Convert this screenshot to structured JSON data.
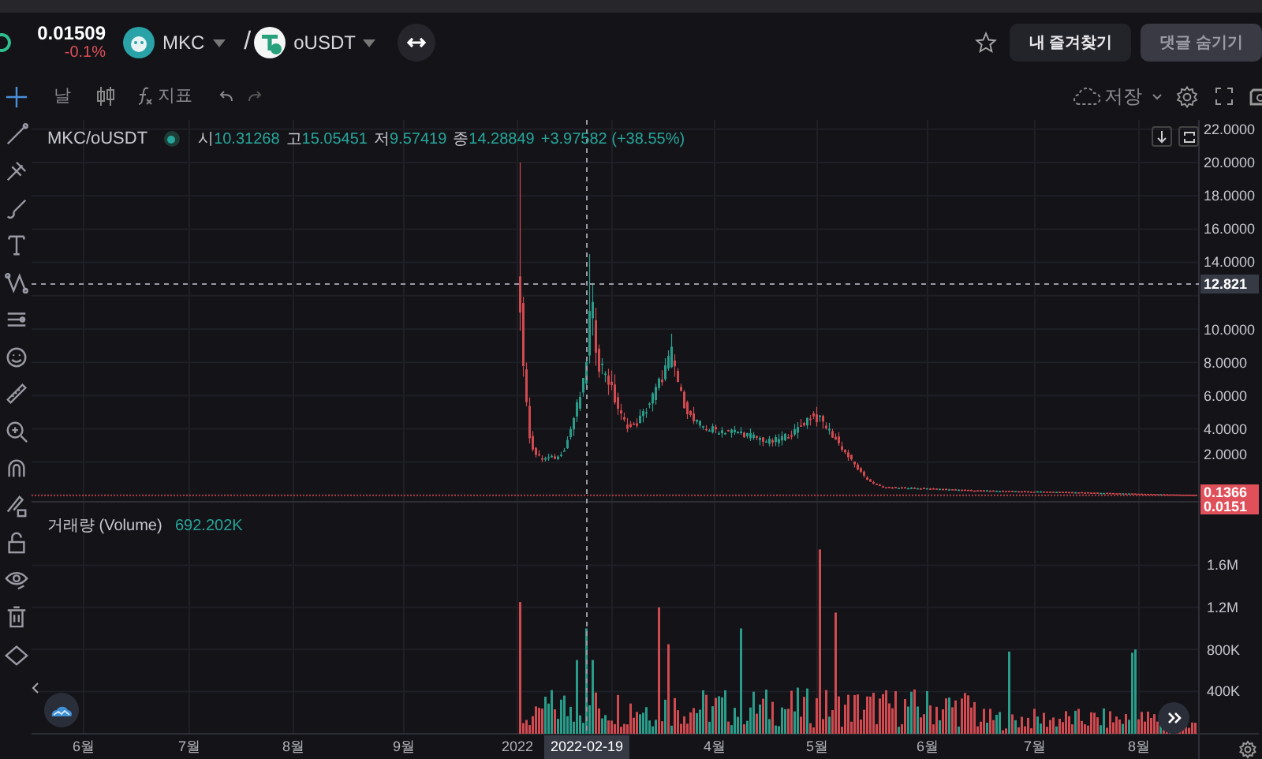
{
  "ticker": {
    "price": "0.01509",
    "change": "-0.1%"
  },
  "pair": {
    "base": "MKC",
    "separator": "/",
    "quote": "oUSDT"
  },
  "header_buttons": [
    {
      "label": "내 즐겨찾기",
      "kind": "primary"
    },
    {
      "label": "댓글 숨기기",
      "kind": "muted"
    }
  ],
  "toolbar": {
    "interval": "날",
    "indicators": "지표",
    "save": "저장"
  },
  "legend": {
    "symbol": "MKC/oUSDT",
    "items": [
      {
        "label": "시",
        "value": "10.31268"
      },
      {
        "label": "고",
        "value": "15.05451"
      },
      {
        "label": "저",
        "value": "9.57419"
      },
      {
        "label": "종",
        "value": "14.28849"
      }
    ],
    "change": "+3.97582 (+38.55%)"
  },
  "price_axis": [
    "22.0000",
    "20.0000",
    "18.0000",
    "16.0000",
    "14.0000",
    "10.0000",
    "8.0000",
    "6.0000",
    "4.0000",
    "2.0000"
  ],
  "price_tags": [
    {
      "value": "12.821",
      "kind": "crosshair"
    },
    {
      "value": "0.1366",
      "kind": "last"
    },
    {
      "value": "0.0151",
      "kind": "last"
    }
  ],
  "volume": {
    "label": "거래량 (Volume)",
    "value": "692.202K",
    "axis": [
      "1.6M",
      "1.2M",
      "800K",
      "400K"
    ]
  },
  "time_axis": [
    {
      "label": "6월",
      "selected": false
    },
    {
      "label": "7월",
      "selected": false
    },
    {
      "label": "8월",
      "selected": false
    },
    {
      "label": "9월",
      "selected": false
    },
    {
      "label": "2022",
      "selected": false
    },
    {
      "label": "2022-02-19",
      "selected": true
    },
    {
      "label": "4월",
      "selected": false
    },
    {
      "label": "5월",
      "selected": false
    },
    {
      "label": "6월",
      "selected": false
    },
    {
      "label": "7월",
      "selected": false
    },
    {
      "label": "8월",
      "selected": false
    }
  ]
}
